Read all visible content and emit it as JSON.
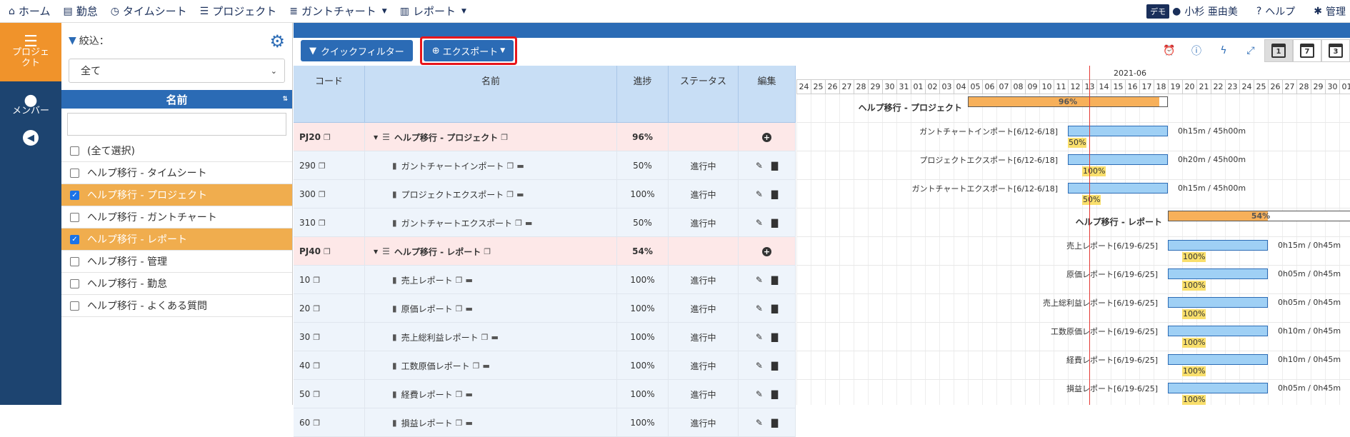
{
  "nav": {
    "home": "ホーム",
    "attendance": "勤怠",
    "timesheet": "タイムシート",
    "project": "プロジェクト",
    "gantt": "ガントチャート",
    "report": "レポート",
    "demo": "デモ",
    "user": "小杉 亜由美",
    "help": "ヘルプ",
    "admin": "管理"
  },
  "leftbar": {
    "project": "プロジェクト",
    "member": "メンバー"
  },
  "filter": {
    "title": "絞込：",
    "select_value": "全て",
    "name_header": "名前",
    "items": [
      {
        "label": "(全て選択)",
        "checked": false
      },
      {
        "label": "ヘルプ移行 - タイムシート",
        "checked": false
      },
      {
        "label": "ヘルプ移行 - プロジェクト",
        "checked": true
      },
      {
        "label": "ヘルプ移行 - ガントチャート",
        "checked": false
      },
      {
        "label": "ヘルプ移行 - レポート",
        "checked": true
      },
      {
        "label": "ヘルプ移行 - 管理",
        "checked": false
      },
      {
        "label": "ヘルプ移行 - 勤怠",
        "checked": false
      },
      {
        "label": "ヘルプ移行 - よくある質問",
        "checked": false
      }
    ]
  },
  "toolbar": {
    "quick_filter": "クイックフィルター",
    "export": "エクスポート",
    "cal_labels": [
      "1",
      "7",
      "3"
    ]
  },
  "grid": {
    "headers": {
      "code": "コード",
      "name": "名前",
      "progress": "進捗",
      "status": "ステータス",
      "edit": "編集"
    },
    "rows": [
      {
        "type": "proj",
        "code": "PJ20",
        "name": "ヘルプ移行 - プロジェクト",
        "progress": "96%",
        "status": ""
      },
      {
        "type": "task",
        "code": "290",
        "name": "ガントチャートインポート",
        "progress": "50%",
        "status": "進行中"
      },
      {
        "type": "task",
        "code": "300",
        "name": "プロジェクトエクスポート",
        "progress": "100%",
        "status": "進行中"
      },
      {
        "type": "task",
        "code": "310",
        "name": "ガントチャートエクスポート",
        "progress": "50%",
        "status": "進行中"
      },
      {
        "type": "proj",
        "code": "PJ40",
        "name": "ヘルプ移行 - レポート",
        "progress": "54%",
        "status": ""
      },
      {
        "type": "task",
        "code": "10",
        "name": "売上レポート",
        "progress": "100%",
        "status": "進行中"
      },
      {
        "type": "task",
        "code": "20",
        "name": "原価レポート",
        "progress": "100%",
        "status": "進行中"
      },
      {
        "type": "task",
        "code": "30",
        "name": "売上総利益レポート",
        "progress": "100%",
        "status": "進行中"
      },
      {
        "type": "task",
        "code": "40",
        "name": "工数原価レポート",
        "progress": "100%",
        "status": "進行中"
      },
      {
        "type": "task",
        "code": "50",
        "name": "経費レポート",
        "progress": "100%",
        "status": "進行中"
      },
      {
        "type": "task",
        "code": "60",
        "name": "損益レポート",
        "progress": "100%",
        "status": "進行中"
      }
    ]
  },
  "gantt": {
    "month": "2021-06",
    "days": [
      "24",
      "25",
      "26",
      "27",
      "28",
      "29",
      "30",
      "31",
      "01",
      "02",
      "03",
      "04",
      "05",
      "06",
      "07",
      "08",
      "09",
      "10",
      "11",
      "12",
      "13",
      "14",
      "15",
      "16",
      "17",
      "18",
      "19",
      "20",
      "21",
      "22",
      "23",
      "24",
      "25",
      "26",
      "27",
      "28",
      "29",
      "30",
      "01"
    ],
    "rows": [
      {
        "label": "ヘルプ移行 - プロジェクト",
        "kind": "proj",
        "pct": "96%"
      },
      {
        "label": "ガントチャートインポート[6/12-6/18]",
        "kind": "task",
        "time": "0h15m / 45h00m",
        "pct": "50%"
      },
      {
        "label": "プロジェクトエクスポート[6/12-6/18]",
        "kind": "task",
        "time": "0h20m / 45h00m",
        "pct": "100%"
      },
      {
        "label": "ガントチャートエクスポート[6/12-6/18]",
        "kind": "task",
        "time": "0h15m / 45h00m",
        "pct": "50%"
      },
      {
        "label": "ヘルプ移行 - レポート",
        "kind": "proj",
        "pct": "54%"
      },
      {
        "label": "売上レポート[6/19-6/25]",
        "kind": "task",
        "time": "0h15m / 0h45m",
        "pct": "100%"
      },
      {
        "label": "原価レポート[6/19-6/25]",
        "kind": "task",
        "time": "0h05m / 0h45m",
        "pct": "100%"
      },
      {
        "label": "売上総利益レポート[6/19-6/25]",
        "kind": "task",
        "time": "0h05m / 0h45m",
        "pct": "100%"
      },
      {
        "label": "工数原価レポート[6/19-6/25]",
        "kind": "task",
        "time": "0h10m / 0h45m",
        "pct": "100%"
      },
      {
        "label": "経費レポート[6/19-6/25]",
        "kind": "task",
        "time": "0h10m / 0h45m",
        "pct": "100%"
      },
      {
        "label": "損益レポート[6/19-6/25]",
        "kind": "task",
        "time": "0h05m / 0h45m",
        "pct": "100%"
      }
    ]
  }
}
